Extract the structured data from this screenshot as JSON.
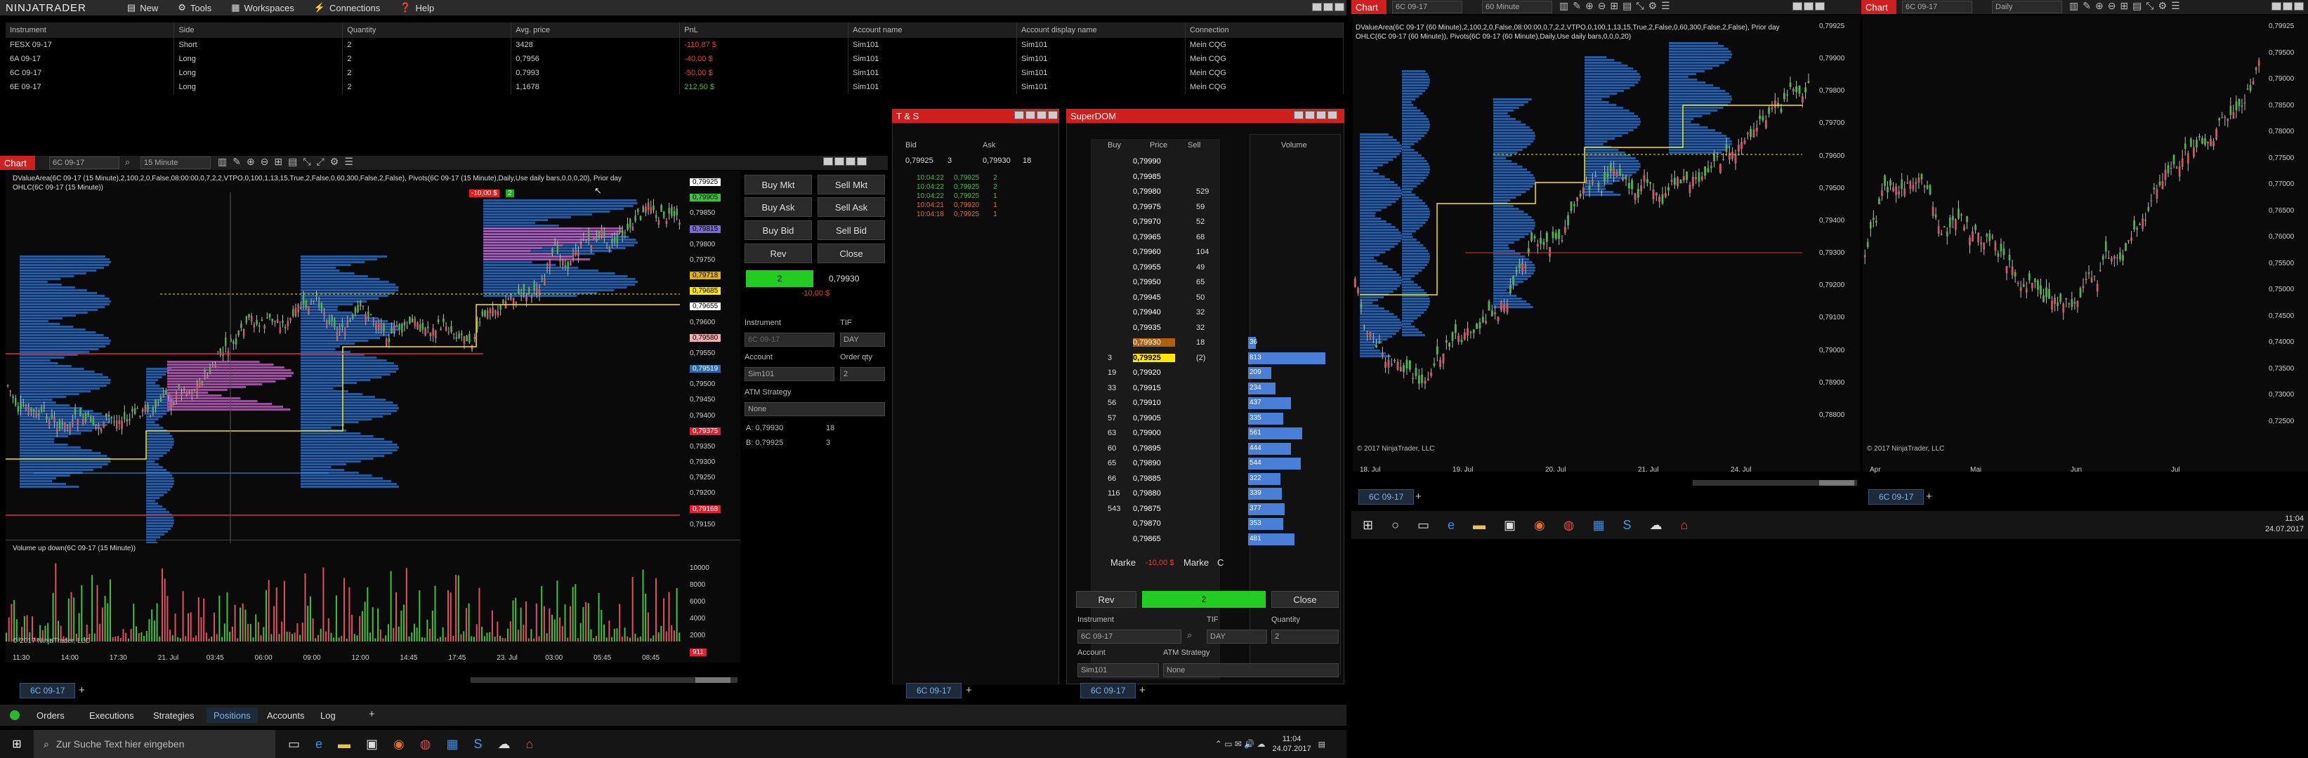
{
  "app": {
    "logo": "NINJATRADER",
    "menu": [
      "New",
      "Tools",
      "Workspaces",
      "Connections",
      "Help"
    ]
  },
  "positions": {
    "headers": [
      "Instrument",
      "Side",
      "Quantity",
      "Avg. price",
      "PnL",
      "Account name",
      "Account display name",
      "Connection"
    ],
    "rows": [
      [
        "FESX 09-17",
        "Short",
        "2",
        "3428",
        "-110,87 $",
        "Sim101",
        "Sim101",
        "Mein CQG"
      ],
      [
        "6A 09-17",
        "Long",
        "2",
        "0,7956",
        "-40,00 $",
        "Sim101",
        "Sim101",
        "Mein CQG"
      ],
      [
        "6C 09-17",
        "Long",
        "2",
        "0,7993",
        "-50,00 $",
        "Sim101",
        "Sim101",
        "Mein CQG"
      ],
      [
        "6E 09-17",
        "Long",
        "2",
        "1,1678",
        "212,50 $",
        "Sim101",
        "Sim101",
        "Mein CQG"
      ]
    ],
    "pnl_colors": [
      "#e04040",
      "#e04040",
      "#e04040",
      "#3fc03f"
    ]
  },
  "chart1": {
    "title": "Chart",
    "instrument": "6C 09-17",
    "period": "15 Minute",
    "indicator_line1": "DValueArea(6C 09-17 (15 Minute),2,100,2,0,False,08:00:00,0,7,2,2,VTPO,0,100,1,13,15,True,2,False,0,60,300,False,2,False), Pivots(6C 09-17 (15 Minute),Daily,Use daily bars,0,0,0,20), Prior day",
    "indicator_line2": "OHLC(6C 09-17 (15 Minute))",
    "volume_title": "Volume up down(6C 09-17 (15 Minute))",
    "copyright": "© 2017 NinjaTrader, LLC",
    "price_labels": [
      "0,79925",
      "0,79905",
      "0,79850",
      "0,79815",
      "0,79800",
      "0,79750",
      "0,79718",
      "0,79685",
      "0,79655",
      "0,79600",
      "0,79580",
      "0,79550",
      "0,79519",
      "0,79500",
      "0,79450",
      "0,79400",
      "0,79375",
      "0,79350",
      "0,79300",
      "0,79250",
      "0,79200",
      "0,79168",
      "0,79150"
    ],
    "vol_labels": [
      "10000",
      "8000",
      "6000",
      "4000",
      "2000",
      "911"
    ],
    "time_labels": [
      "11:30",
      "14:00",
      "17:30",
      "21. Jul",
      "03:45",
      "06:00",
      "09:00",
      "12:00",
      "14:45",
      "17:45",
      "23. Jul",
      "03:00",
      "05:45",
      "08:45"
    ],
    "pnl_tag": "-10,00 $",
    "pos_qty": "2",
    "tab": "6C 09-17"
  },
  "chart_trader": {
    "buy_mkt": "Buy Mkt",
    "sell_mkt": "Sell Mkt",
    "buy_ask": "Buy Ask",
    "sell_ask": "Sell Ask",
    "buy_bid": "Buy Bid",
    "sell_bid": "Sell Bid",
    "rev": "Rev",
    "close": "Close",
    "pos_qty": "2",
    "pos_price": "0,79930",
    "pos_pnl": "-10,00 $",
    "instrument_lbl": "Instrument",
    "instrument": "6C 09-17",
    "tif_lbl": "TIF",
    "tif": "DAY",
    "account_lbl": "Account",
    "account": "Sim101",
    "order_qty_lbl": "Order qty",
    "order_qty": "2",
    "atm_lbl": "ATM Strategy",
    "atm": "None",
    "ask_lbl": "A: 0,79930",
    "ask_size": "18",
    "bid_lbl": "B: 0,79925",
    "bid_size": "3"
  },
  "ts": {
    "title": "T & S",
    "bid_hdr": "Bid",
    "ask_hdr": "Ask",
    "bid": "0,79925",
    "bid_sz": "3",
    "ask": "0,79930",
    "ask_sz": "18",
    "rows": [
      [
        "10:04:22",
        "0,79925",
        "2",
        "#3fc03f"
      ],
      [
        "10:04:22",
        "0,79925",
        "2",
        "#3fc03f"
      ],
      [
        "10:04:22",
        "0,79925",
        "1",
        "#3fc03f"
      ],
      [
        "10:04:21",
        "0,79920",
        "1",
        "#e07020"
      ],
      [
        "10:04:18",
        "0,79925",
        "1",
        "#e07020"
      ]
    ],
    "tab": "6C 09-17"
  },
  "dom": {
    "title": "SuperDOM",
    "hdr_buy": "Buy",
    "hdr_price": "Price",
    "hdr_sell": "Sell",
    "hdr_vol": "Volume",
    "rows": [
      [
        "",
        "0,79990",
        "",
        ""
      ],
      [
        "",
        "0,79985",
        "",
        ""
      ],
      [
        "",
        "0,79980",
        "529",
        ""
      ],
      [
        "",
        "0,79975",
        "59",
        ""
      ],
      [
        "",
        "0,79970",
        "52",
        ""
      ],
      [
        "",
        "0,79965",
        "68",
        ""
      ],
      [
        "",
        "0,79960",
        "104",
        ""
      ],
      [
        "",
        "0,79955",
        "49",
        ""
      ],
      [
        "",
        "0,79950",
        "65",
        ""
      ],
      [
        "",
        "0,79945",
        "50",
        ""
      ],
      [
        "",
        "0,79940",
        "32",
        ""
      ],
      [
        "",
        "0,79935",
        "32",
        ""
      ],
      [
        "",
        "0,79930",
        "18",
        "36"
      ],
      [
        "3",
        "0,79925",
        "(2)",
        "813"
      ],
      [
        "19",
        "0,79920",
        "",
        "209"
      ],
      [
        "33",
        "0,79915",
        "",
        "234"
      ],
      [
        "56",
        "0,79910",
        "",
        "437"
      ],
      [
        "57",
        "0,79905",
        "",
        "335"
      ],
      [
        "63",
        "0,79900",
        "",
        "561"
      ],
      [
        "60",
        "0,79895",
        "",
        "444"
      ],
      [
        "65",
        "0,79890",
        "",
        "544"
      ],
      [
        "66",
        "0,79885",
        "",
        "322"
      ],
      [
        "116",
        "0,79880",
        "",
        "339"
      ],
      [
        "543",
        "0,79875",
        "",
        "377"
      ],
      [
        "",
        "0,79870",
        "",
        "353"
      ],
      [
        "",
        "0,79865",
        "",
        "481"
      ]
    ],
    "vol_fracs": [
      0.1,
      1,
      0.3,
      0.35,
      0.55,
      0.45,
      0.7,
      0.55,
      0.68,
      0.42,
      0.44,
      0.47,
      0.45,
      0.6
    ],
    "market_left": "Marke",
    "market_pnl": "-10,00 $",
    "market_right": "Marke",
    "market_c": "C",
    "rev": "Rev",
    "pos_qty": "2",
    "close": "Close",
    "instrument_lbl": "Instrument",
    "instrument": "6C 09-17",
    "tif_lbl": "TIF",
    "tif": "DAY",
    "qty_lbl": "Quantity",
    "qty": "2",
    "account_lbl": "Account",
    "account": "Sim101",
    "atm_lbl": "ATM Strategy",
    "atm": "None",
    "tab": "6C 09-17"
  },
  "bottom_tabs": [
    "Orders",
    "Executions",
    "Strategies",
    "Positions",
    "Accounts",
    "Log"
  ],
  "taskbar1": {
    "search": "Zur Suche Text hier eingeben",
    "time": "11:04",
    "date": "24.07.2017"
  },
  "chart2": {
    "title": "Chart",
    "instrument": "6C 09-17",
    "period": "60 Minute",
    "indicator_line1": "DValueArea(6C 09-17 (60 Minute),2,100,2,0,False,08:00:00,0,7,2,2,VTPO,0,100,1,13,15,True,2,False,0,60,300,False,2,False), Prior day",
    "indicator_line2": "OHLC(6C 09-17 (60 Minute)), Pivots(6C 09-17 (60 Minute),Daily,Use daily bars,0,0,0,20)",
    "price_labels": [
      "0,79925",
      "0,79900",
      "0,79800",
      "0,79700",
      "0,79600",
      "0,79500",
      "0,79400",
      "0,79300",
      "0,79200",
      "0,79100",
      "0,79000",
      "0,78900",
      "0,78800"
    ],
    "time_labels": [
      "18. Jul",
      "19. Jul",
      "20. Jul",
      "21. Jul",
      "24. Jul"
    ],
    "copyright": "© 2017 NinjaTrader, LLC",
    "tab": "6C 09-17"
  },
  "chart3": {
    "title": "Chart",
    "instrument": "6C 09-17",
    "period": "Daily",
    "price_labels": [
      "0,79925",
      "0,79500",
      "0,79000",
      "0,78500",
      "0,78000",
      "0,77500",
      "0,77000",
      "0,76500",
      "0,76000",
      "0,75500",
      "0,75000",
      "0,74500",
      "0,74000",
      "0,73500",
      "0,73000",
      "0,72500"
    ],
    "time_labels": [
      "Apr",
      "Mai",
      "Jun",
      "Jul"
    ],
    "copyright": "© 2017 NinjaTrader, LLC",
    "tab": "6C 09-17"
  },
  "taskbar2": {
    "time": "11:04",
    "date": "24.07.2017"
  }
}
